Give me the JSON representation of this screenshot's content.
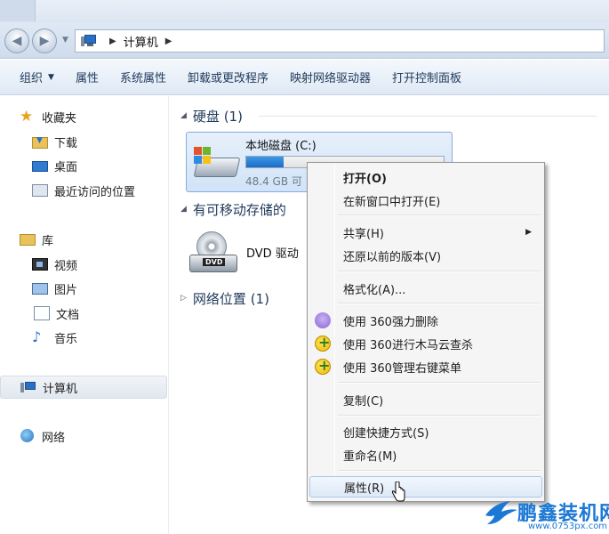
{
  "address": {
    "segments": [
      "计算机"
    ]
  },
  "toolbar": {
    "organize": "组织",
    "properties": "属性",
    "system_properties": "系统属性",
    "uninstall": "卸载或更改程序",
    "map_drive": "映射网络驱动器",
    "control_panel": "打开控制面板"
  },
  "sidebar": {
    "favorites": "收藏夹",
    "downloads": "下载",
    "desktop": "桌面",
    "recent": "最近访问的位置",
    "libraries": "库",
    "videos": "视频",
    "pictures": "图片",
    "documents": "文档",
    "music": "音乐",
    "computer": "计算机",
    "network": "网络"
  },
  "content": {
    "hdd_group": "硬盘 (1)",
    "removable_group": "有可移动存储的",
    "network_group": "网络位置 (1)",
    "drive_c": {
      "name": "本地磁盘 (C:)",
      "free_text": "48.4 GB 可",
      "used_fraction": 0.19
    },
    "dvd": {
      "name": "DVD 驱动",
      "label": "DVD"
    }
  },
  "context_menu": {
    "open": "打开(O)",
    "open_new_window": "在新窗口中打开(E)",
    "share": "共享(H)",
    "restore": "还原以前的版本(V)",
    "format": "格式化(A)...",
    "shred_360": "使用 360强力删除",
    "trojan_360": "使用 360进行木马云查杀",
    "menu_360": "使用 360管理右键菜单",
    "copy": "复制(C)",
    "shortcut": "创建快捷方式(S)",
    "rename": "重命名(M)",
    "properties": "属性(R)"
  },
  "watermark": {
    "brand": "鹏鑫装机网",
    "url": "www.0753px.com"
  },
  "colors": {
    "accent": "#1e395b",
    "selection": "#dde9f8",
    "watermark": "#1b78d4"
  }
}
